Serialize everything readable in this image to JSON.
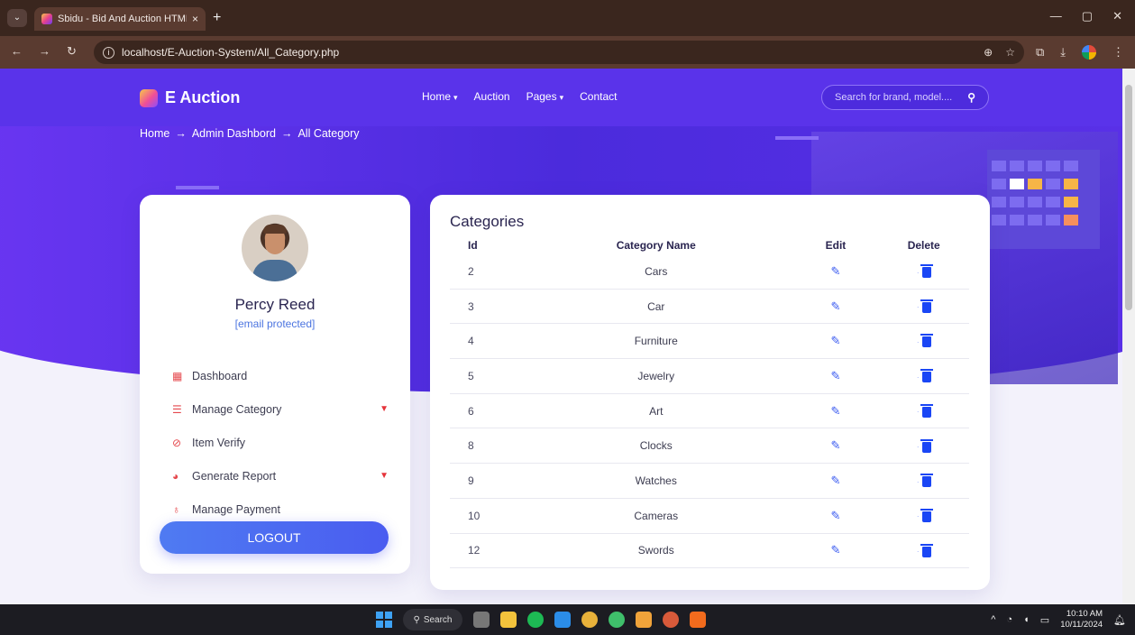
{
  "browser": {
    "tab_title": "Sbidu - Bid And Auction HTML",
    "tab_close": "×",
    "new_tab": "+",
    "url": "localhost/E-Auction-System/All_Category.php",
    "win_minimize": "—",
    "win_restore": "▢",
    "win_close": "✕"
  },
  "site": {
    "brand": "E Auction",
    "nav": [
      {
        "label": "Home",
        "caret": "▾"
      },
      {
        "label": "Auction"
      },
      {
        "label": "Pages",
        "caret": "▾"
      },
      {
        "label": "Contact"
      }
    ],
    "search_placeholder": "Search for brand, model....",
    "breadcrumb": [
      "Home",
      "→",
      "Admin Dashbord",
      "→",
      "All Category"
    ]
  },
  "profile": {
    "name": "Percy Reed",
    "email": "[email protected]",
    "menu": [
      {
        "label": "Dashboard",
        "icon": "dashboard-icon",
        "glyph": "▦",
        "dropdown": false
      },
      {
        "label": "Manage Category",
        "icon": "list-icon",
        "glyph": "☰",
        "dropdown": true
      },
      {
        "label": "Item Verify",
        "icon": "check-circle-icon",
        "glyph": "⊘",
        "dropdown": false
      },
      {
        "label": "Generate Report",
        "icon": "pie-chart-icon",
        "glyph": "◕",
        "dropdown": true
      },
      {
        "label": "Manage Payment",
        "icon": "award-icon",
        "glyph": "♁",
        "dropdown": false
      }
    ],
    "dropdown_glyph": "▼",
    "logout": "LOGOUT"
  },
  "table": {
    "title": "Categories",
    "headers": {
      "id": "Id",
      "name": "Category Name",
      "edit": "Edit",
      "delete": "Delete"
    },
    "rows": [
      {
        "id": "2",
        "name": "Cars"
      },
      {
        "id": "3",
        "name": "Car"
      },
      {
        "id": "4",
        "name": "Furniture"
      },
      {
        "id": "5",
        "name": "Jewelry"
      },
      {
        "id": "6",
        "name": "Art"
      },
      {
        "id": "8",
        "name": "Clocks"
      },
      {
        "id": "9",
        "name": "Watches"
      },
      {
        "id": "10",
        "name": "Cameras"
      },
      {
        "id": "12",
        "name": "Swords"
      }
    ]
  },
  "taskbar": {
    "search": "Search",
    "time": "10:10 AM",
    "date": "10/11/2024"
  },
  "colors": {
    "hero": "#5a33ea",
    "accent_blue": "#4a5cf0",
    "menu_icon_red": "#e5484d"
  }
}
